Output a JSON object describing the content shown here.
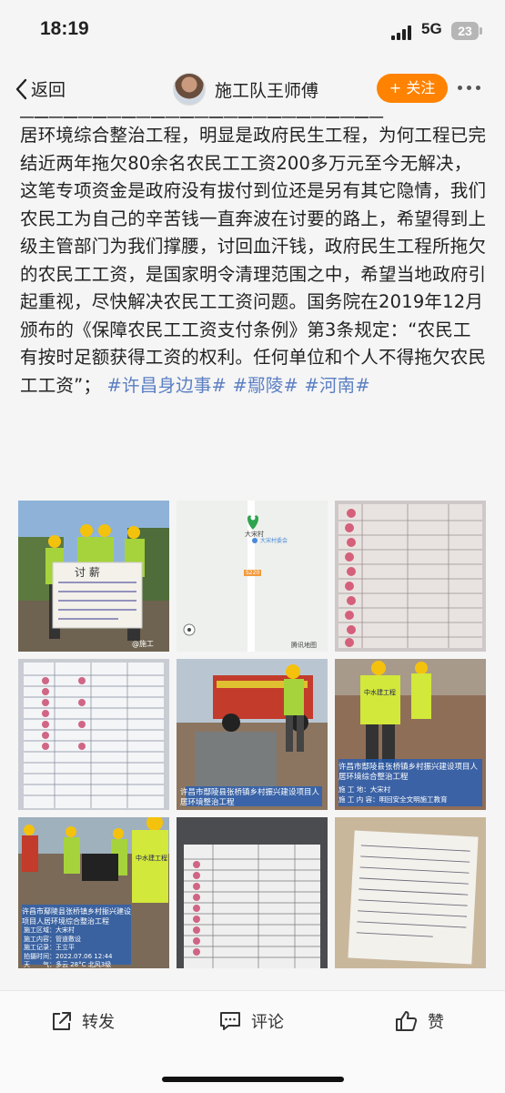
{
  "status_bar": {
    "time": "18:19",
    "network": "5G",
    "battery": "23"
  },
  "nav": {
    "back_label": "返回",
    "author_name": "施工队王师傅",
    "follow_label": "+ 关注"
  },
  "post": {
    "body": "居环境综合整治工程，明显是政府民生工程，为何工程已完结近两年拖欠80余名农民工工资200多万元至今无解决，这笔专项资金是政府没有拔付到位还是另有其它隐情，我们农民工为自己的辛苦钱一直奔波在讨要的路上，希望得到上级主管部门为我们撑腰，讨回血汗钱，政府民生工程所拖欠的农民工工资，是国家明令清理范围之中，希望当地政府引起重视，尽快解决农民工工资问题。国务院在2019年12月颁布的《保障农民工工资支付条例》第3条规定：“农民工有按时足额获得工资的权利。任何单位和个人不得拖欠农民工工资”；",
    "tags": [
      "#许昌身边事#",
      "#鄢陵#",
      "#河南#"
    ]
  },
  "images": {
    "img1": {
      "banner_title": "讨 薪",
      "watermark": "@施工"
    },
    "img2": {
      "village_label": "大宋村",
      "poi_label": "大宋村委会",
      "route_label": "S220",
      "map_brand": "腾讯地图"
    },
    "img5": {
      "caption": "许昌市鄢陵县张桥镇乡村振兴建设项目人居环境整治工程"
    },
    "img6": {
      "vest_text": "中水建工程",
      "caption_1": "许昌市鄢陵县张桥镇乡村振兴建设项目人居环境综合整治工程",
      "caption_2": "施 工 地：大宋村",
      "caption_3": "施 工 内 容：明回安全文明施工教育"
    },
    "img7": {
      "vest_text": "中水建工程",
      "caption_title": "许昌市鄢陵县张桥镇乡村振兴建设项目人居环境综合整治工程",
      "caption_rows": [
        "施工区域：大宋村",
        "施工内容：管道敷设",
        "施工记录：王立平",
        "拍摄时间：2022.07.06 12:44",
        "天　　气：多云 28°C  北风3级"
      ]
    }
  },
  "actions": {
    "forward_label": "转发",
    "comment_label": "评论",
    "like_label": "赞"
  },
  "colors": {
    "accent": "#ff8200",
    "link": "#5b7fc3"
  }
}
